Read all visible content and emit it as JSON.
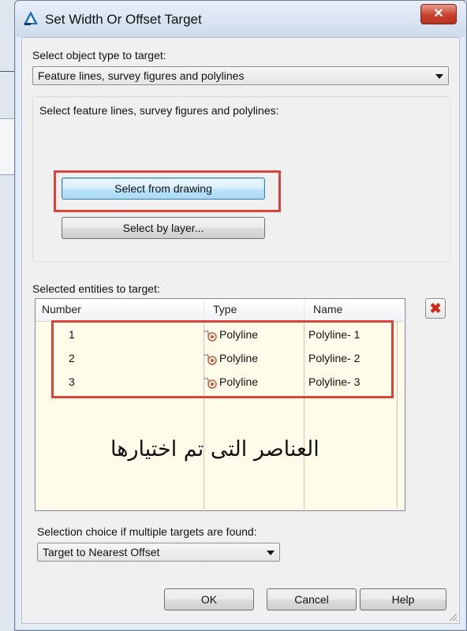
{
  "window": {
    "title": "Set Width Or Offset Target",
    "close_symbol": "✕"
  },
  "object_type": {
    "label": "Select object type to target:",
    "value": "Feature lines, survey figures and polylines"
  },
  "select_group": {
    "label": "Select feature lines, survey figures and polylines:",
    "select_from_drawing": "Select from drawing",
    "select_by_layer": "Select by layer..."
  },
  "entities": {
    "label": "Selected entities to target:",
    "columns": [
      "Number",
      "Type",
      "Name"
    ],
    "rows": [
      {
        "number": "1",
        "type": "Polyline",
        "name": "Polyline- 1"
      },
      {
        "number": "2",
        "type": "Polyline",
        "name": "Polyline- 2"
      },
      {
        "number": "3",
        "type": "Polyline",
        "name": "Polyline- 3"
      }
    ],
    "annotation": "العناصر التى تم اختيارها",
    "delete_symbol": "✖"
  },
  "selection_choice": {
    "label": "Selection choice if multiple targets are found:",
    "value": "Target to Nearest Offset"
  },
  "buttons": {
    "ok": "OK",
    "cancel": "Cancel",
    "help": "Help"
  },
  "colors": {
    "highlight_red": "#d9453b",
    "list_background": "#fffdea"
  },
  "icons": [
    "autocad-app-icon",
    "close-icon",
    "dropdown-arrow-icon",
    "polyline-icon",
    "delete-icon",
    "resize-grip-icon"
  ]
}
